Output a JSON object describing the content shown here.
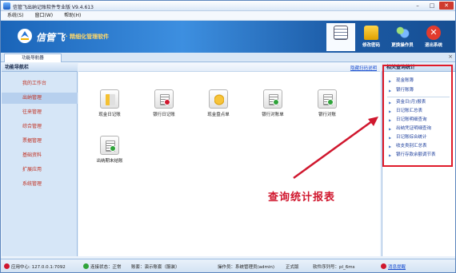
{
  "window": {
    "title": "信管飞出纳记账软件专业版 V9.4.613"
  },
  "menu": [
    "系统(S)",
    "窗口(W)",
    "帮助(H)"
  ],
  "banner": {
    "logo_text": "信管飞",
    "tagline": "· 精细化管理软件"
  },
  "toolbar": [
    {
      "label": "",
      "icon": "document-icon",
      "active": true
    },
    {
      "label": "修改密码",
      "icon": "lock-icon"
    },
    {
      "label": "更换操作员",
      "icon": "users-icon"
    },
    {
      "label": "退出系统",
      "icon": "exit-icon"
    }
  ],
  "tab": {
    "label": "功能导航器"
  },
  "nav": {
    "title": "功能导航栏",
    "items": [
      "我的工作台",
      "出纳管理",
      "往来管理",
      "综合管理",
      "票据管理",
      "基础资料",
      "扩展应用",
      "系统管理"
    ],
    "selected_index": 1
  },
  "content": {
    "hide_link": "隐藏扫码说明",
    "functions": [
      {
        "label": "现金日记账",
        "icon": "cash-journal-icon"
      },
      {
        "label": "银行日记账",
        "icon": "bank-journal-icon"
      },
      {
        "label": "现金盘点单",
        "icon": "coin-count-icon"
      },
      {
        "label": "银行对账单",
        "icon": "bank-statement-icon"
      },
      {
        "label": "银行对账",
        "icon": "reconcile-icon"
      },
      {
        "label": "出纳期末结账",
        "icon": "period-close-icon"
      }
    ]
  },
  "annotation": "查询统计报表",
  "right_pane": {
    "title": "相关查询统计",
    "group1": [
      "现金账簿",
      "银行账簿"
    ],
    "group2": [
      "资金日(月)报表",
      "日记账汇总表",
      "日记账明细查询",
      "出纳凭证明细查询",
      "日记账综合统计",
      "收支类别汇总表",
      "银行存款余额调节表"
    ]
  },
  "status": {
    "app_center": "应用中心: 127.0.0.1:7092",
    "conn_state": "连接状态：正常",
    "account": "账套：演示账套（服装）",
    "operator": "操作员：系统管理员(admin)",
    "edition": "正式版",
    "serial": "软件序列号：pl_6ms",
    "message_link": "消息提醒",
    "colors": {
      "error": "#d0172e",
      "ok": "#2fa33a"
    }
  }
}
